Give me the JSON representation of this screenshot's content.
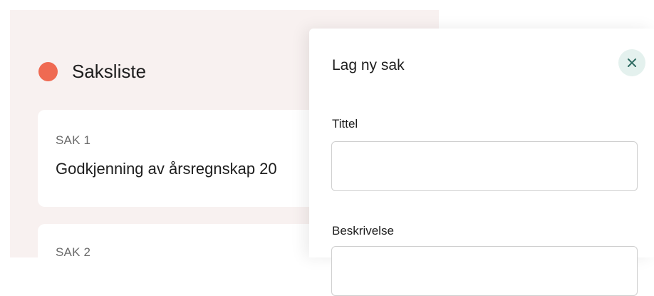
{
  "case_list": {
    "title": "Saksliste",
    "status_color": "#ef6a52",
    "items": [
      {
        "label": "SAK 1",
        "title": "Godkjenning av årsregnskap 20"
      },
      {
        "label": "SAK 2",
        "title": ""
      }
    ]
  },
  "new_case_modal": {
    "title": "Lag ny sak",
    "close_icon": "close-icon",
    "fields": {
      "title_label": "Tittel",
      "title_value": "",
      "description_label": "Beskrivelse",
      "description_value": ""
    }
  }
}
